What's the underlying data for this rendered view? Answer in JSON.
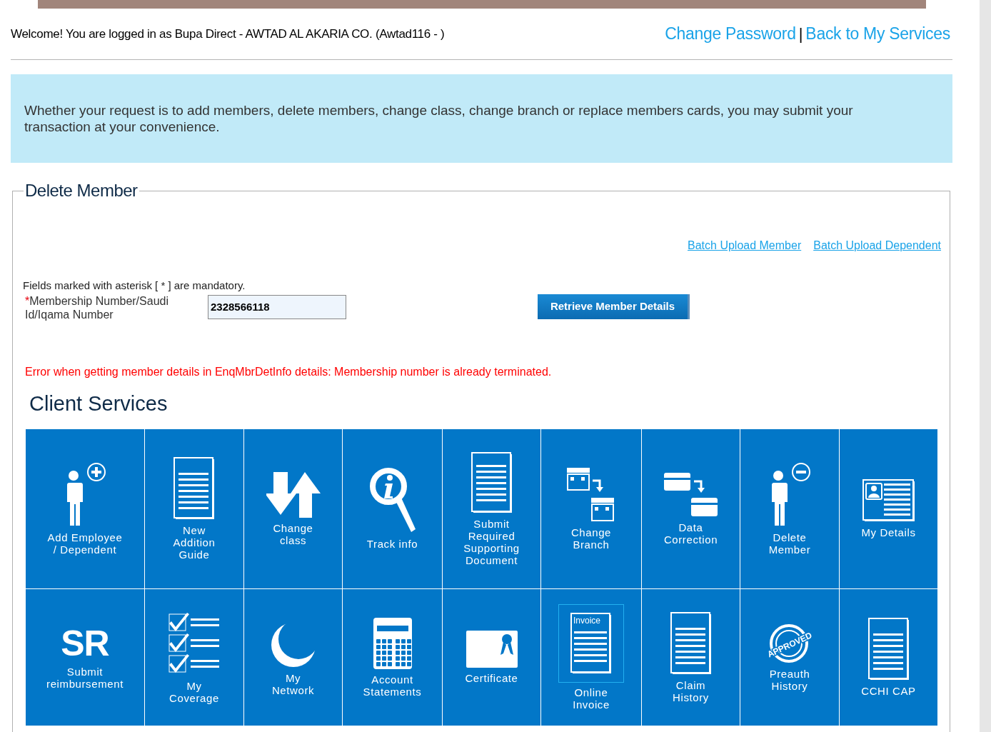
{
  "header": {
    "welcome": "Welcome! You are logged in as Bupa Direct - AWTAD AL AKARIA CO. (Awtad116 - )",
    "links": [
      "Change Password",
      "Back to My Services"
    ],
    "separator": "|"
  },
  "info_banner": "Whether your request is to add members, delete members, change class, change branch or replace members cards, you may submit your transaction at your convenience.",
  "form": {
    "legend": "Delete Member",
    "batch_links": [
      "Batch Upload Member",
      "Batch Upload Dependent"
    ],
    "mandatory_note": "Fields marked with asterisk [ * ] are mandatory.",
    "field": {
      "asterisk": "*",
      "label": "Membership Number/Saudi Id/Iqama Number",
      "value": "2328566118"
    },
    "button": "Retrieve Member Details",
    "error": "Error when getting member details in EnqMbrDetInfo details: Membership number is already terminated."
  },
  "client_services": {
    "title": "Client Services",
    "tiles": [
      {
        "label": "Add Employee\n/ Dependent",
        "kind": "person-plus",
        "selected": false
      },
      {
        "label": "New\nAddition\nGuide",
        "kind": "document",
        "selected": false
      },
      {
        "label": "Change\nclass",
        "kind": "arrows",
        "selected": false
      },
      {
        "label": "Track info",
        "kind": "magnifier",
        "selected": false
      },
      {
        "label": "Submit\nRequired\nSupporting\nDocument",
        "kind": "document-tall",
        "selected": false
      },
      {
        "label": "Change\nBranch",
        "kind": "buildings",
        "selected": false
      },
      {
        "label": "Data\nCorrection",
        "kind": "cards",
        "selected": false
      },
      {
        "label": "Delete\nMember",
        "kind": "person-minus",
        "selected": false
      },
      {
        "label": "My Details",
        "kind": "id-card",
        "selected": false
      },
      {
        "label": "Submit\nreimbursement",
        "kind": "lettering",
        "icon_text": "SR",
        "selected": false
      },
      {
        "label": "My\nCoverage",
        "kind": "checklist",
        "selected": false
      },
      {
        "label": "My\nNetwork",
        "kind": "crescent",
        "selected": false
      },
      {
        "label": "Account\nStatements",
        "kind": "calculator",
        "selected": false
      },
      {
        "label": "Certificate",
        "kind": "certificate",
        "selected": false
      },
      {
        "label": "Online\nInvoice",
        "kind": "invoice",
        "icon_text": "Invoice",
        "selected": true
      },
      {
        "label": "Claim\nHistory",
        "kind": "document",
        "selected": false
      },
      {
        "label": "Preauth\nHistory",
        "kind": "stamp",
        "icon_text": "APPROVED",
        "selected": false
      },
      {
        "label": "CCHI CAP",
        "kind": "document",
        "selected": false
      }
    ]
  }
}
